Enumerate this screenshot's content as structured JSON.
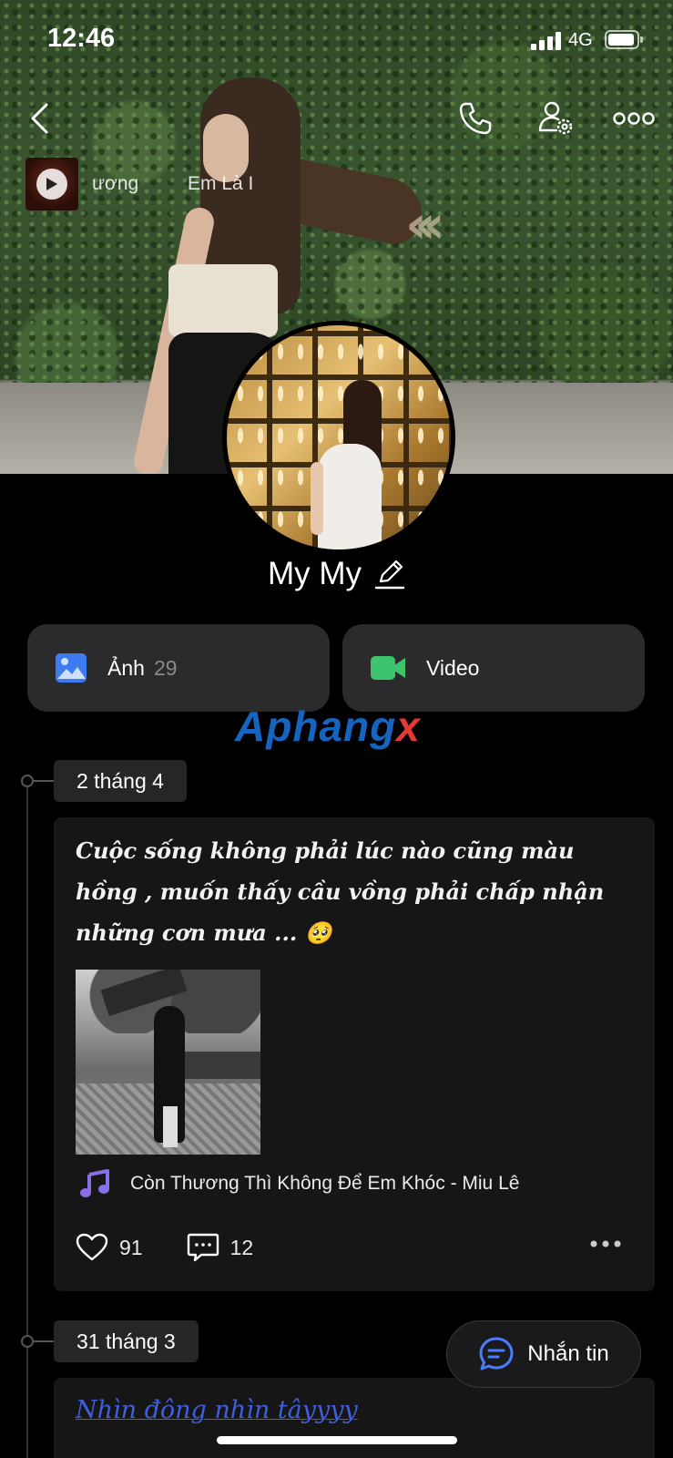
{
  "status_bar": {
    "time": "12:46",
    "network": "4G"
  },
  "music": {
    "text_left": "ương",
    "text_right": "Em Là I"
  },
  "profile": {
    "name": "My My"
  },
  "media": {
    "photos_label": "Ảnh",
    "photos_count": "29",
    "videos_label": "Video"
  },
  "watermark": {
    "main": "Aphang",
    "x": "x"
  },
  "timeline": [
    {
      "date": "2 tháng 4",
      "text": "Cuộc sống không phải lúc nào cũng màu hồng , muốn thấy cầu vồng phải chấp nhận những cơn mưa ... 🥺",
      "song": "Còn Thương Thì Không Để Em Khóc - Miu Lê",
      "likes": "91",
      "comments": "12"
    },
    {
      "date": "31 tháng 3",
      "text": "Nhìn đông nhìn tâyyyy"
    }
  ],
  "message_button": {
    "label": "Nhắn tin"
  },
  "colors": {
    "accent_blue": "#4a7cff",
    "video_green": "#3ec46d",
    "photo_blue": "#3d7bf0",
    "music_purple": "#8b6fe8"
  }
}
